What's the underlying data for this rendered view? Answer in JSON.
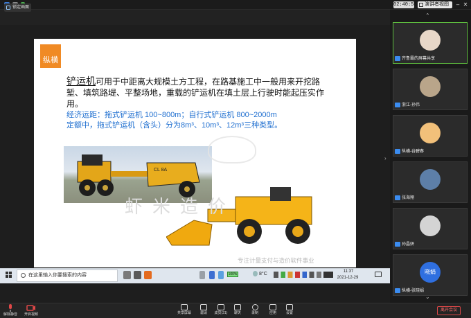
{
  "topbar": {
    "clock": "02:40:58",
    "view_label": "演讲者视图"
  },
  "sharebar": {
    "tag": "锁定画面"
  },
  "slide": {
    "badge": "纵横",
    "para_em": "铲运机",
    "para": "可用于中距离大规模土方工程，在路基施工中一般用来开挖路堑、填筑路堤、平整场地，重载的铲运机在填土层上行驶时能起压实作用。",
    "blue_line1": "经济运距：拖式铲运机 100~800m；自行式铲运机 800~2000m",
    "blue_line2": "定额中，拖式铲运机（含头）分为8m³、10m³、12m³三种类型。",
    "watermark": "虾米造价",
    "footer": "专注计量支付与造价软件事业"
  },
  "taskbar": {
    "search_placeholder": "在这里输入你要搜索的内容",
    "battery": "100%",
    "temp": "8°C",
    "time": "11:37",
    "date": "2021-12-29"
  },
  "participants": [
    {
      "name": "齐鲁霸的屏幕共享",
      "active": true,
      "color": "#e8d7c8"
    },
    {
      "name": "浙江-孙伟",
      "active": false,
      "color": "#b9a58a"
    },
    {
      "name": "纵横-谷碧春",
      "active": false,
      "color": "#f2c07a"
    },
    {
      "name": "张海翔",
      "active": false,
      "color": "#5d7fa8"
    },
    {
      "name": "孙晶妍",
      "active": false,
      "color": "#d4d4d4"
    },
    {
      "name": "纵横-张晓娟",
      "active": false,
      "color": "#2f6fe0",
      "initials": "晓娟"
    }
  ],
  "toolbar": {
    "mute": "解除静音",
    "video": "开启视频",
    "items": [
      "共享屏幕",
      "邀请",
      "成员(21)",
      "聊天",
      "录制",
      "应用",
      "设置"
    ],
    "leave": "离开会议"
  }
}
